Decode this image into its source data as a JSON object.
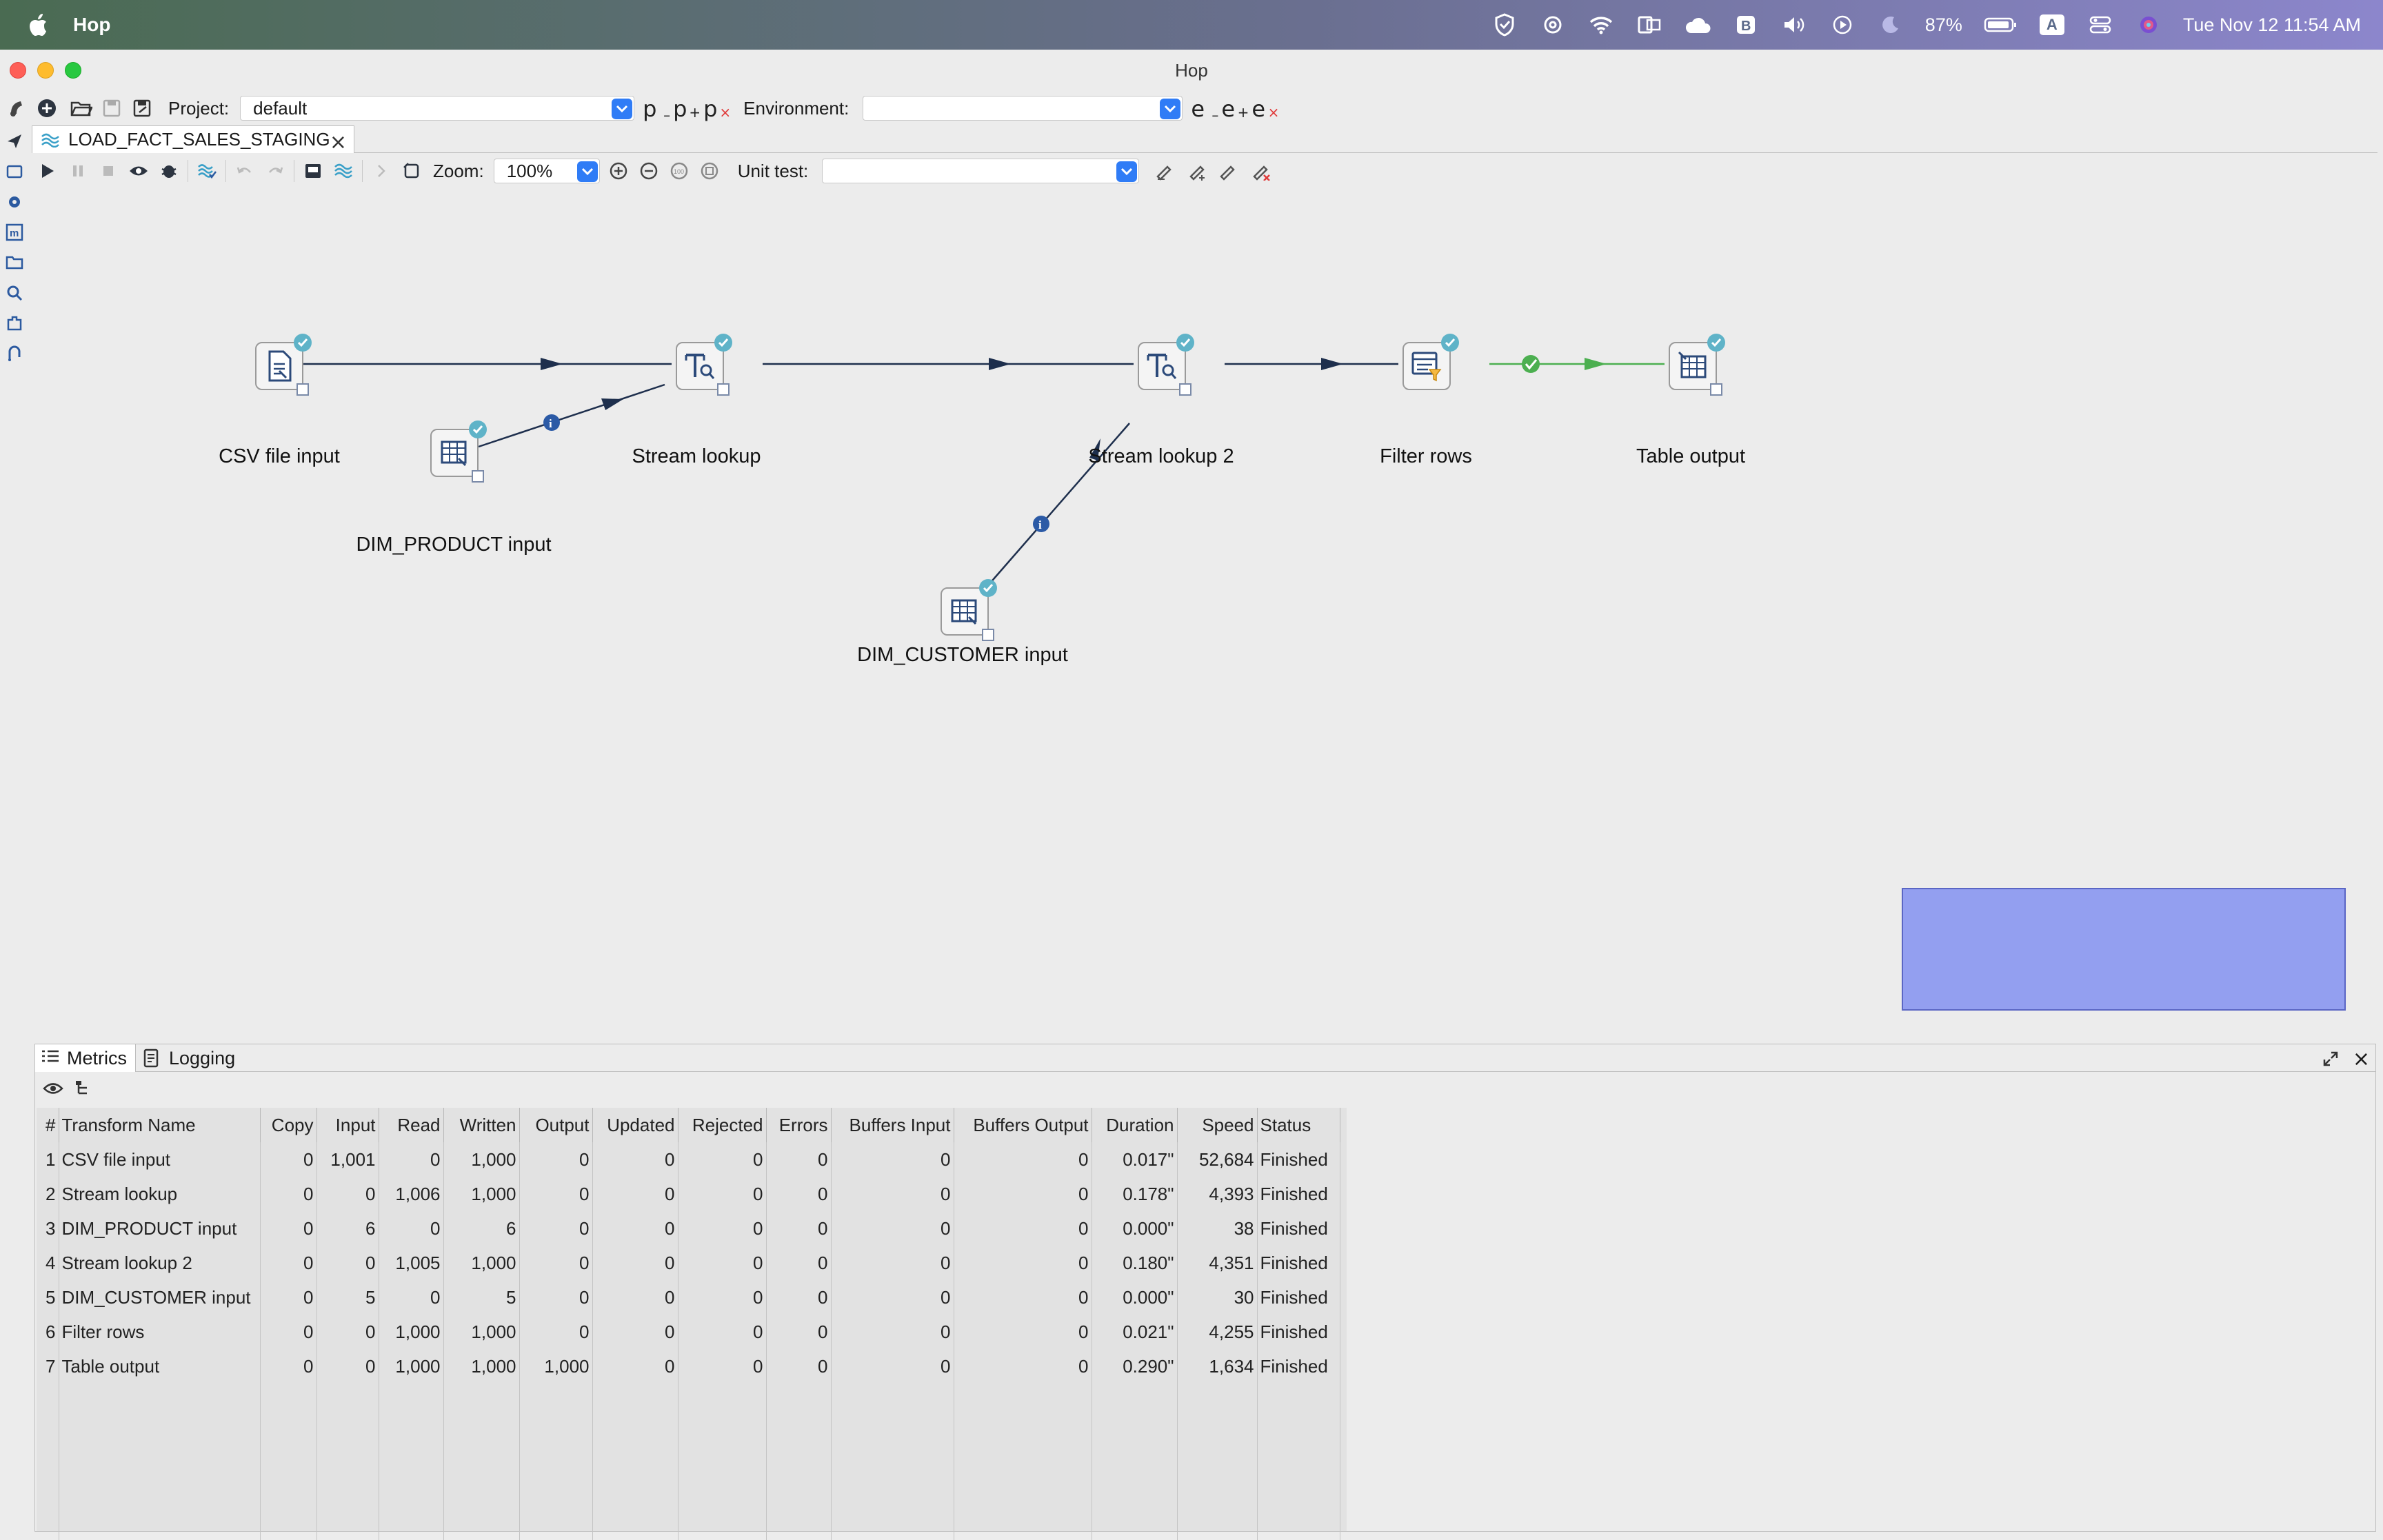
{
  "menubar": {
    "app_name": "Hop",
    "battery": "87%",
    "input_source": "A",
    "datetime": "Tue Nov 12  11:54 AM"
  },
  "window": {
    "title": "Hop"
  },
  "main_toolbar": {
    "project_label": "Project:",
    "project_value": "default",
    "environment_label": "Environment:",
    "environment_value": "",
    "project_icons": [
      "p",
      "p",
      "p"
    ],
    "environment_icons": [
      "e",
      "e",
      "e"
    ]
  },
  "tab": {
    "title": "LOAD_FACT_SALES_STAGING"
  },
  "pipeline_toolbar": {
    "zoom_label": "Zoom:",
    "zoom_value": "100%",
    "unit_test_label": "Unit test:",
    "unit_test_value": ""
  },
  "nodes": [
    {
      "id": "csv",
      "label": "CSV file input",
      "icon": "csv-file-icon"
    },
    {
      "id": "lookup1",
      "label": "Stream lookup",
      "icon": "stream-lookup-icon"
    },
    {
      "id": "dimprod",
      "label": "DIM_PRODUCT input",
      "icon": "table-input-icon"
    },
    {
      "id": "lookup2",
      "label": "Stream lookup 2",
      "icon": "stream-lookup-icon"
    },
    {
      "id": "dimcust",
      "label": "DIM_CUSTOMER input",
      "icon": "table-input-icon"
    },
    {
      "id": "filter",
      "label": "Filter rows",
      "icon": "filter-rows-icon"
    },
    {
      "id": "tableout",
      "label": "Table output",
      "icon": "table-output-icon"
    }
  ],
  "bottom_panel": {
    "tabs": [
      "Metrics",
      "Logging"
    ]
  },
  "metrics": {
    "columns": [
      "#",
      "Transform Name",
      "Copy",
      "Input",
      "Read",
      "Written",
      "Output",
      "Updated",
      "Rejected",
      "Errors",
      "Buffers Input",
      "Buffers Output",
      "Duration",
      "Speed",
      "Status"
    ],
    "rows": [
      [
        "1",
        "CSV file input",
        "0",
        "1,001",
        "0",
        "1,000",
        "0",
        "0",
        "0",
        "0",
        "0",
        "0",
        "0.017\"",
        "52,684",
        "Finished"
      ],
      [
        "2",
        "Stream lookup",
        "0",
        "0",
        "1,006",
        "1,000",
        "0",
        "0",
        "0",
        "0",
        "0",
        "0",
        "0.178\"",
        "4,393",
        "Finished"
      ],
      [
        "3",
        "DIM_PRODUCT input",
        "0",
        "6",
        "0",
        "6",
        "0",
        "0",
        "0",
        "0",
        "0",
        "0",
        "0.000\"",
        "38",
        "Finished"
      ],
      [
        "4",
        "Stream lookup 2",
        "0",
        "0",
        "1,005",
        "1,000",
        "0",
        "0",
        "0",
        "0",
        "0",
        "0",
        "0.180\"",
        "4,351",
        "Finished"
      ],
      [
        "5",
        "DIM_CUSTOMER input",
        "0",
        "5",
        "0",
        "5",
        "0",
        "0",
        "0",
        "0",
        "0",
        "0",
        "0.000\"",
        "30",
        "Finished"
      ],
      [
        "6",
        "Filter rows",
        "0",
        "0",
        "1,000",
        "1,000",
        "0",
        "0",
        "0",
        "0",
        "0",
        "0",
        "0.021\"",
        "4,255",
        "Finished"
      ],
      [
        "7",
        "Table output",
        "0",
        "0",
        "1,000",
        "1,000",
        "1,000",
        "0",
        "0",
        "0",
        "0",
        "0",
        "0.290\"",
        "1,634",
        "Finished"
      ]
    ]
  },
  "colors": {
    "accent": "#2f7cf6",
    "hop_arrow": "#1e2f4d",
    "hop_true": "#4caf50",
    "info_badge": "#2b5aa6",
    "node_check": "#5fb3c8",
    "navigator": "#939ff0"
  }
}
